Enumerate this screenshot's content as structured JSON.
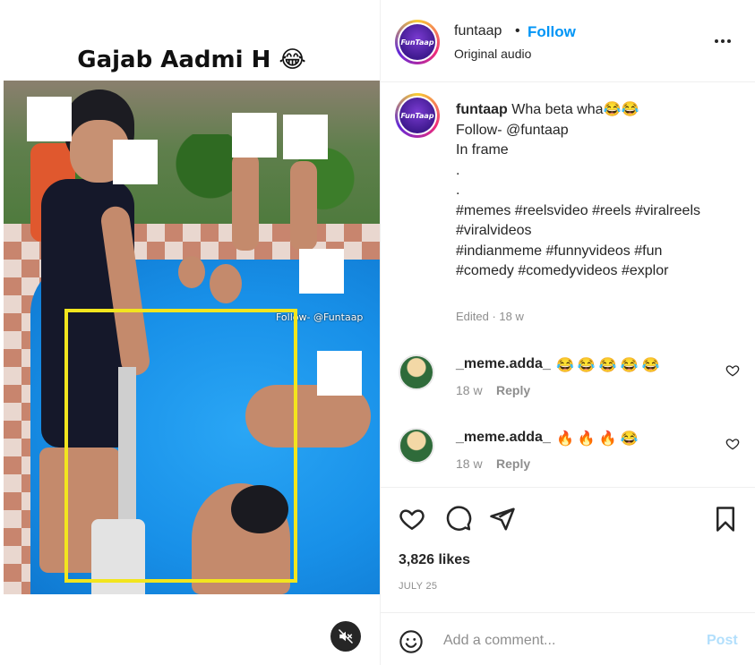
{
  "media": {
    "title": "Gajab Aadmi H 😂",
    "watermark": "Follow- @Funtaap"
  },
  "header": {
    "avatar_text": "FunTaap",
    "username": "funtaap",
    "separator": "•",
    "follow_label": "Follow",
    "audio": "Original audio",
    "more_icon": "more-options-icon"
  },
  "caption": {
    "username": "funtaap",
    "lines": [
      "Wha beta wha😂😂",
      "Follow- @funtaap",
      "In frame",
      ".",
      ".",
      "",
      "#memes #reelsvideo #reels #viralreels",
      "#viralvideos",
      "#indianmeme #funnyvideos #fun",
      "#comedy #comedyvideos #explor"
    ],
    "meta": "Edited · 18 w"
  },
  "comments": [
    {
      "username": "_meme.adda_",
      "emoji": "😂😂😂😂😂",
      "time": "18 w",
      "reply": "Reply"
    },
    {
      "username": "_meme.adda_",
      "emoji": "🔥🔥🔥😂",
      "time": "18 w",
      "reply": "Reply"
    }
  ],
  "actions": {
    "likes": "3,826 likes",
    "date": "JULY 25"
  },
  "add_comment": {
    "placeholder": "Add a comment...",
    "post_label": "Post"
  },
  "colors": {
    "accent": "#0095f6",
    "post_disabled": "#b2dffc",
    "highlight": "#f2e51e",
    "muted": "#8e8e8e"
  }
}
